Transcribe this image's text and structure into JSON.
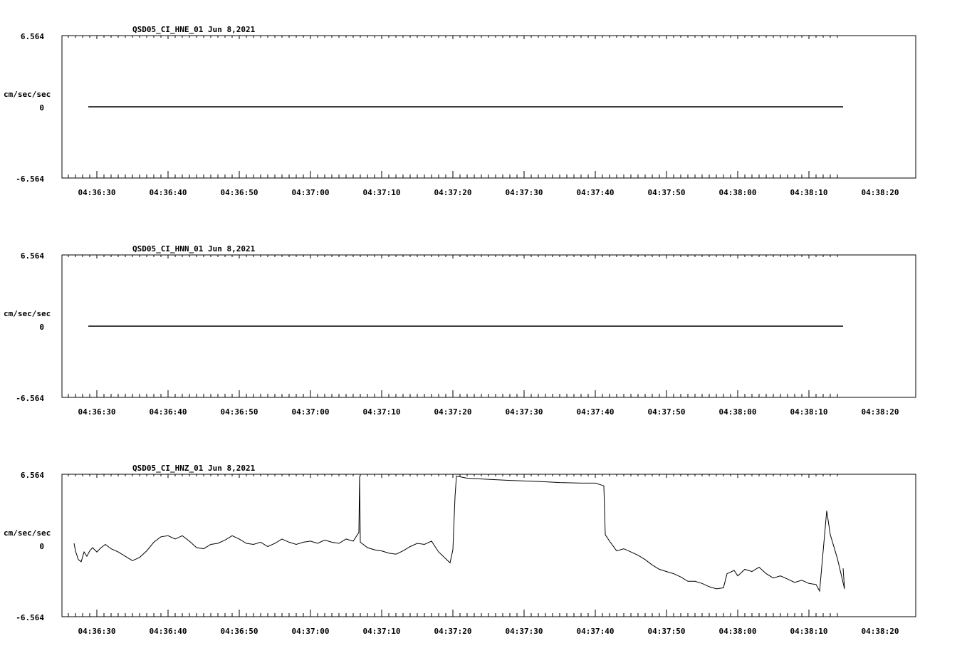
{
  "colors": {
    "background": "#ffffff",
    "trace": "#000000",
    "axis": "#000000"
  },
  "x_tick_labels": [
    "04:36:30",
    "04:36:40",
    "04:36:50",
    "04:37:00",
    "04:37:10",
    "04:37:20",
    "04:37:30",
    "04:37:40",
    "04:37:50",
    "04:38:00",
    "04:38:10",
    "04:38:20"
  ],
  "chart_data": [
    {
      "type": "line",
      "title": "QSD05_CI_HNE_01  Jun 8,2021",
      "ylabel": "cm/sec/sec",
      "ylim": [
        -6.564,
        6.564
      ],
      "y_tick_labels": [
        "6.564",
        "0",
        "-6.564"
      ],
      "xlim_seconds": [
        -15.0,
        104.8
      ],
      "x_unit": "seconds after 04:36:30",
      "x_tick_labels": [
        "04:36:30",
        "04:36:40",
        "04:36:50",
        "04:37:00",
        "04:37:10",
        "04:37:20",
        "04:37:30",
        "04:37:40",
        "04:37:50",
        "04:38:00",
        "04:38:10",
        "04:38:20"
      ],
      "series": [
        {
          "points": [
            [
              -1.2,
              0
            ],
            [
              104.8,
              0
            ]
          ]
        }
      ]
    },
    {
      "type": "line",
      "title": "QSD05_CI_HNN_01  Jun 8,2021",
      "ylabel": "cm/sec/sec",
      "ylim": [
        -6.564,
        6.564
      ],
      "y_tick_labels": [
        "6.564",
        "0",
        "-6.564"
      ],
      "xlim_seconds": [
        -15.0,
        104.8
      ],
      "x_unit": "seconds after 04:36:30",
      "x_tick_labels": [
        "04:36:30",
        "04:36:40",
        "04:36:50",
        "04:37:00",
        "04:37:10",
        "04:37:20",
        "04:37:30",
        "04:37:40",
        "04:37:50",
        "04:38:00",
        "04:38:10",
        "04:38:20"
      ],
      "series": [
        {
          "points": [
            [
              -1.2,
              0
            ],
            [
              104.8,
              0
            ]
          ]
        }
      ]
    },
    {
      "type": "line",
      "title": "QSD05_CI_HNZ_01  Jun 8,2021",
      "ylabel": "cm/sec/sec",
      "ylim": [
        -6.564,
        6.564
      ],
      "y_tick_labels": [
        "6.564",
        "0",
        "-6.564"
      ],
      "xlim_seconds": [
        -15.0,
        104.8
      ],
      "x_unit": "seconds after 04:36:30",
      "x_tick_labels": [
        "04:36:30",
        "04:36:40",
        "04:36:50",
        "04:37:00",
        "04:37:10",
        "04:37:20",
        "04:37:30",
        "04:37:40",
        "04:37:50",
        "04:38:00",
        "04:38:10",
        "04:38:20"
      ],
      "series": [
        {
          "points": [
            [
              -3.2,
              0.2
            ],
            [
              -3.0,
              -0.5
            ],
            [
              -2.6,
              -1.3
            ],
            [
              -2.2,
              -1.5
            ],
            [
              -1.8,
              -0.6
            ],
            [
              -1.4,
              -1.0
            ],
            [
              -1.0,
              -0.5
            ],
            [
              -0.6,
              -0.2
            ],
            [
              0.0,
              -0.6
            ],
            [
              0.6,
              -0.2
            ],
            [
              1.2,
              0.1
            ],
            [
              2.0,
              -0.3
            ],
            [
              3.0,
              -0.6
            ],
            [
              4.0,
              -1.0
            ],
            [
              5.0,
              -1.4
            ],
            [
              6.0,
              -1.1
            ],
            [
              7.0,
              -0.5
            ],
            [
              8.0,
              0.3
            ],
            [
              9.0,
              0.8
            ],
            [
              10.0,
              0.9
            ],
            [
              11.0,
              0.6
            ],
            [
              12.0,
              0.9
            ],
            [
              13.0,
              0.4
            ],
            [
              14.0,
              -0.2
            ],
            [
              15.0,
              -0.3
            ],
            [
              16.0,
              0.1
            ],
            [
              17.0,
              0.2
            ],
            [
              18.0,
              0.5
            ],
            [
              19.0,
              0.9
            ],
            [
              20.0,
              0.6
            ],
            [
              21.0,
              0.2
            ],
            [
              22.0,
              0.1
            ],
            [
              23.0,
              0.3
            ],
            [
              24.0,
              -0.1
            ],
            [
              25.0,
              0.2
            ],
            [
              26.0,
              0.6
            ],
            [
              27.0,
              0.3
            ],
            [
              28.0,
              0.1
            ],
            [
              29.0,
              0.3
            ],
            [
              30.0,
              0.4
            ],
            [
              31.0,
              0.2
            ],
            [
              32.0,
              0.5
            ],
            [
              33.0,
              0.3
            ],
            [
              34.0,
              0.2
            ],
            [
              35.0,
              0.6
            ],
            [
              36.0,
              0.4
            ],
            [
              36.8,
              1.2
            ],
            [
              36.9,
              6.4
            ],
            [
              37.0,
              0.3
            ],
            [
              38.0,
              -0.2
            ],
            [
              39.0,
              -0.4
            ],
            [
              40.0,
              -0.5
            ],
            [
              41.0,
              -0.7
            ],
            [
              42.0,
              -0.8
            ],
            [
              43.0,
              -0.5
            ],
            [
              44.0,
              -0.1
            ],
            [
              45.0,
              0.2
            ],
            [
              46.0,
              0.1
            ],
            [
              47.0,
              0.4
            ],
            [
              48.0,
              -0.6
            ],
            [
              49.6,
              -1.6
            ],
            [
              50.0,
              -0.4
            ],
            [
              50.3,
              4.5
            ],
            [
              50.5,
              6.4
            ],
            [
              52.0,
              6.2
            ],
            [
              55.0,
              6.1
            ],
            [
              58.0,
              6.0
            ],
            [
              62.0,
              5.9
            ],
            [
              65.0,
              5.8
            ],
            [
              68.0,
              5.75
            ],
            [
              70.0,
              5.75
            ],
            [
              71.2,
              5.5
            ],
            [
              71.4,
              1.0
            ],
            [
              72.0,
              0.4
            ],
            [
              73.0,
              -0.5
            ],
            [
              74.0,
              -0.3
            ],
            [
              75.0,
              -0.6
            ],
            [
              76.0,
              -0.9
            ],
            [
              77.0,
              -1.3
            ],
            [
              78.0,
              -1.8
            ],
            [
              79.0,
              -2.2
            ],
            [
              80.0,
              -2.4
            ],
            [
              81.0,
              -2.6
            ],
            [
              82.0,
              -2.9
            ],
            [
              83.0,
              -3.3
            ],
            [
              84.0,
              -3.3
            ],
            [
              85.0,
              -3.5
            ],
            [
              86.0,
              -3.8
            ],
            [
              87.0,
              -4.0
            ],
            [
              88.0,
              -3.9
            ],
            [
              88.5,
              -2.6
            ],
            [
              89.5,
              -2.3
            ],
            [
              90.0,
              -2.8
            ],
            [
              91.0,
              -2.2
            ],
            [
              92.0,
              -2.4
            ],
            [
              93.0,
              -2.0
            ],
            [
              94.0,
              -2.6
            ],
            [
              95.0,
              -3.0
            ],
            [
              96.0,
              -2.8
            ],
            [
              97.0,
              -3.1
            ],
            [
              98.0,
              -3.4
            ],
            [
              99.0,
              -3.2
            ],
            [
              100.0,
              -3.5
            ],
            [
              101.0,
              -3.6
            ],
            [
              101.5,
              -4.2
            ],
            [
              102.5,
              3.2
            ],
            [
              103.0,
              1.0
            ],
            [
              104.0,
              -1.2
            ],
            [
              105.0,
              -4.0
            ],
            [
              104.8,
              -2.1
            ]
          ]
        }
      ]
    }
  ]
}
